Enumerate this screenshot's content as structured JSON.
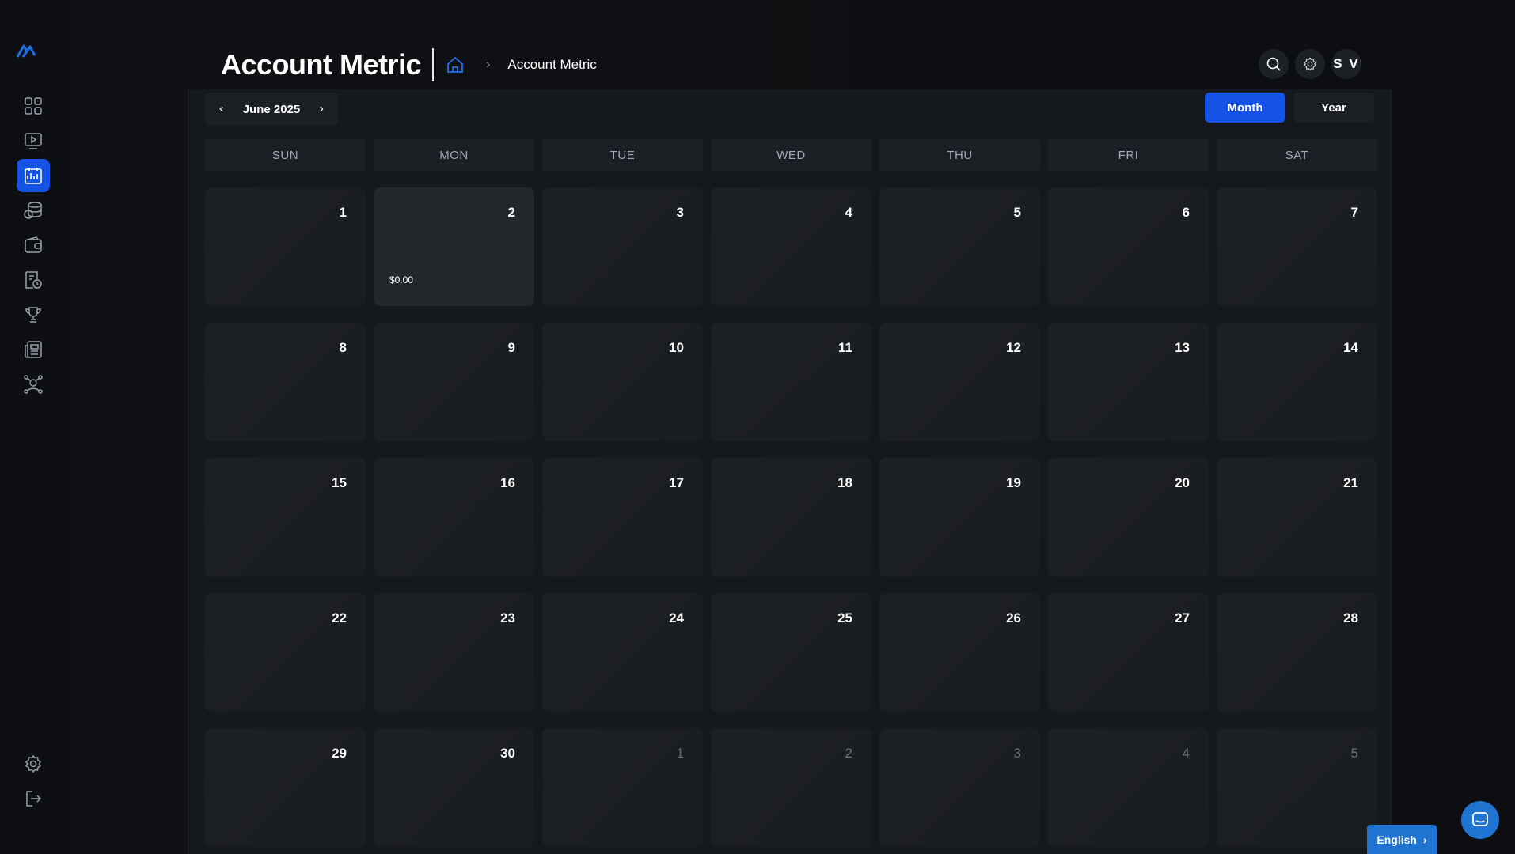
{
  "header": {
    "title": "Account Metric",
    "breadcrumb": "Account Metric",
    "avatar_initials": "S V"
  },
  "sidebar": {
    "items": [
      {
        "name": "dashboard",
        "icon": "grid-icon"
      },
      {
        "name": "videos",
        "icon": "video-play-icon"
      },
      {
        "name": "account-metric",
        "icon": "calendar-chart-icon",
        "active": true
      },
      {
        "name": "coins",
        "icon": "coins-icon"
      },
      {
        "name": "wallet",
        "icon": "wallet-icon"
      },
      {
        "name": "reports",
        "icon": "report-clock-icon"
      },
      {
        "name": "trophy",
        "icon": "trophy-icon"
      },
      {
        "name": "news",
        "icon": "newspaper-icon"
      },
      {
        "name": "affiliates",
        "icon": "network-user-icon"
      }
    ],
    "bottom": [
      {
        "name": "settings",
        "icon": "gear-icon"
      },
      {
        "name": "logout",
        "icon": "logout-icon"
      }
    ]
  },
  "calendar": {
    "month_label": "June 2025",
    "views": [
      {
        "label": "Month",
        "active": true
      },
      {
        "label": "Year",
        "active": false
      }
    ],
    "weekdays": [
      "SUN",
      "MON",
      "TUE",
      "WED",
      "THU",
      "FRI",
      "SAT"
    ],
    "days": [
      {
        "day": "1"
      },
      {
        "day": "2",
        "amount": "$0.00",
        "highlight": true
      },
      {
        "day": "3"
      },
      {
        "day": "4"
      },
      {
        "day": "5"
      },
      {
        "day": "6"
      },
      {
        "day": "7"
      },
      {
        "day": "8"
      },
      {
        "day": "9"
      },
      {
        "day": "10"
      },
      {
        "day": "11"
      },
      {
        "day": "12"
      },
      {
        "day": "13"
      },
      {
        "day": "14"
      },
      {
        "day": "15"
      },
      {
        "day": "16"
      },
      {
        "day": "17"
      },
      {
        "day": "18"
      },
      {
        "day": "19"
      },
      {
        "day": "20"
      },
      {
        "day": "21"
      },
      {
        "day": "22"
      },
      {
        "day": "23"
      },
      {
        "day": "24"
      },
      {
        "day": "25"
      },
      {
        "day": "26"
      },
      {
        "day": "27"
      },
      {
        "day": "28"
      },
      {
        "day": "29"
      },
      {
        "day": "30"
      },
      {
        "day": "1",
        "other": true
      },
      {
        "day": "2",
        "other": true
      },
      {
        "day": "3",
        "other": true
      },
      {
        "day": "4",
        "other": true
      },
      {
        "day": "5",
        "other": true
      }
    ]
  },
  "footer": {
    "language": "English"
  },
  "colors": {
    "accent": "#1553e6",
    "chat": "#1f74d1",
    "background": "#0d0f12",
    "cell": "#1d2023"
  }
}
